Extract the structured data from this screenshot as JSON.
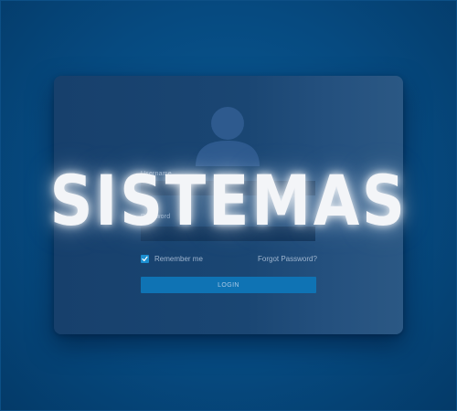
{
  "headline": "SISTEMAS",
  "login_form": {
    "username_label": "Username",
    "username_value": "",
    "password_label": "Password",
    "password_value": "",
    "remember_label": "Remember me",
    "remember_checked": true,
    "forgot_label": "Forgot Password?",
    "login_label": "LOGIN"
  },
  "icons": {
    "avatar": "user-silhouette-icon",
    "checkbox": "checkmark-icon"
  },
  "colors": {
    "background": "#064a80",
    "card": "#1a4673",
    "button": "#0f73b4",
    "checkbox": "#1c8fd0",
    "headline": "#f3f5f8"
  }
}
